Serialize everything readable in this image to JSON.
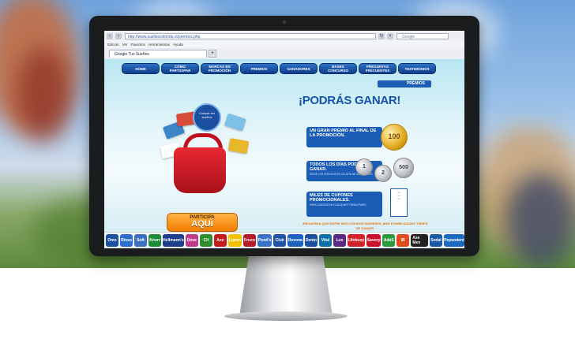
{
  "colors": {
    "nav_blue": "#1e5fb3",
    "accent_orange": "#f07c00",
    "headline_blue": "#1554ad"
  },
  "browser": {
    "address": "http://www.suelloscolondu.cl/premios.php",
    "search_placeholder": "Google",
    "menu": [
      "Edición",
      "Ver",
      "Favoritos",
      "Herramientas",
      "Ayuda"
    ],
    "tab_label": "Google Tus Sueños"
  },
  "nav": [
    "HOME",
    "CÓMO PARTICIPAR",
    "MARCAS EN PROMOCIÓN",
    "PREMIOS",
    "GANADORES",
    "BASES CONCURSO",
    "PREGUNTAS FRECUENTES",
    "TESTIMONIOS"
  ],
  "section_ribbon": "PREMIOS",
  "promo": {
    "badge": "Cumple tus sueños",
    "cta_line1": "PARTICIPA",
    "cta_line2": "AQUÍ"
  },
  "headline": "¡PODRÁS GANAR!",
  "prizes": [
    {
      "title": "UN GRAN PREMIO AL FINAL DE LA PROMOCIÓN.",
      "subtitle": ""
    },
    {
      "title": "TODOS LOS DÍAS PODRÁS GANAR.",
      "subtitle": "SIGUE LOS SORTEOS EN LA LISTA DE GANADORES"
    },
    {
      "title": "MILES DE CUPONES PROMOCIONALES.",
      "subtitle": "PARA CANJEAR EN CUALQUIER TIENDA PARIS."
    }
  ],
  "medals": {
    "gold": "100",
    "silver": [
      "1",
      "2",
      "500"
    ]
  },
  "footer_note": "¡RECUERDA QUE ENTRE MÁS CÓDIGOS INGRESES, MÁS POSIBILIDADES TIENES DE GANAR!",
  "brands": [
    {
      "name": "Omo",
      "color": "#1b4fa0"
    },
    {
      "name": "Rinso",
      "color": "#2a6fd0"
    },
    {
      "name": "Soft",
      "color": "#3b6fc2"
    },
    {
      "name": "Knorr",
      "color": "#1f8a3a"
    },
    {
      "name": "Hellmann's",
      "color": "#1e3f8a"
    },
    {
      "name": "Dove",
      "color": "#c33a8c"
    },
    {
      "name": "Cif",
      "color": "#2f8f2f"
    },
    {
      "name": "Axe",
      "color": "#c21e1e"
    },
    {
      "name": "Lipton",
      "color": "#f2c200"
    },
    {
      "name": "Fruco",
      "color": "#b21d2b"
    },
    {
      "name": "Pond's",
      "color": "#3a74c8"
    },
    {
      "name": "Club",
      "color": "#2054a8"
    },
    {
      "name": "Rexona",
      "color": "#1e62c0"
    },
    {
      "name": "Dento",
      "color": "#1c4f9f"
    },
    {
      "name": "Vital",
      "color": "#0d6fa8"
    },
    {
      "name": "Lux",
      "color": "#5a2a82"
    },
    {
      "name": "Lifebuoy",
      "color": "#d1212b"
    },
    {
      "name": "Savory",
      "color": "#c8102e"
    },
    {
      "name": "AdeS",
      "color": "#2d9a3c"
    },
    {
      "name": "IB",
      "color": "#e04a1c"
    },
    {
      "name": "Axe Men",
      "color": "#222222"
    },
    {
      "name": "Sedal",
      "color": "#1b5aa5"
    },
    {
      "name": "Pepsodent",
      "color": "#1c6ac0"
    }
  ]
}
